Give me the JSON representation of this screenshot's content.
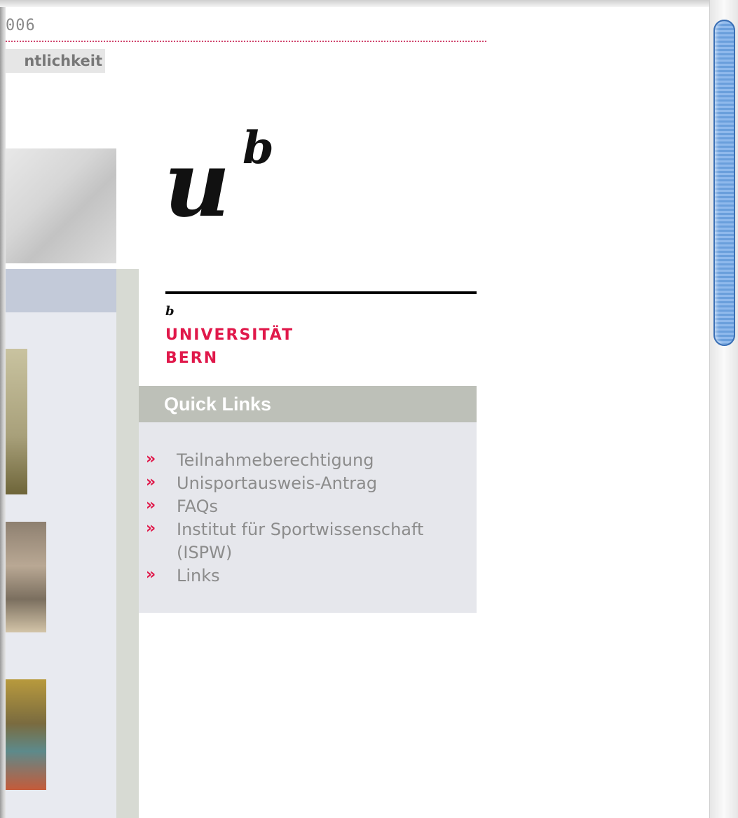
{
  "header": {
    "date_fragment": "006",
    "nav_fragment": "ntlichkeit"
  },
  "logo": {
    "u": "u",
    "b_superscript": "b",
    "b_small": "b",
    "line1": "UNIVERSITÄT",
    "line2": "BERN"
  },
  "quick_links": {
    "title": "Quick Links",
    "items": [
      {
        "label": "Teilnahmeberechtigung"
      },
      {
        "label": "Unisportausweis-Antrag"
      },
      {
        "label": "FAQs"
      },
      {
        "label": "Institut für Sportwissenschaft (ISPW)"
      },
      {
        "label": "Links"
      }
    ]
  },
  "bullet_glyph": "»",
  "colors": {
    "accent": "#e0184a",
    "quick_links_header": "#bdc0b8",
    "quick_links_panel": "#e6e7ec",
    "link_text": "#8c8c8c"
  }
}
